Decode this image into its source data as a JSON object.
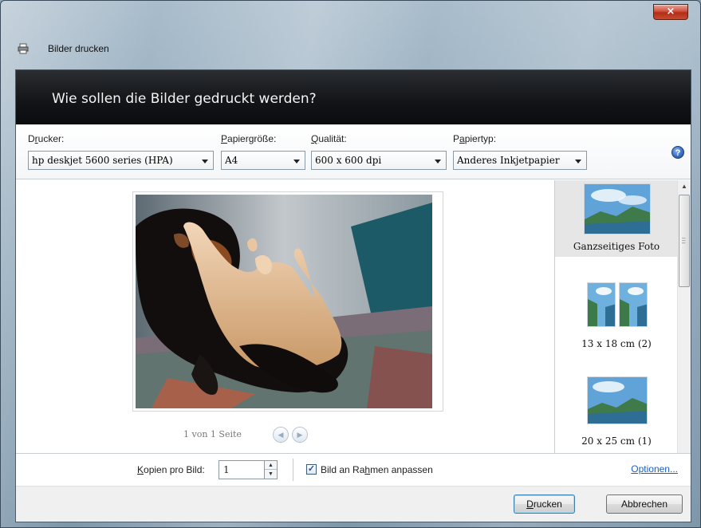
{
  "window": {
    "title": "Bilder drucken",
    "close_glyph": "×"
  },
  "header": {
    "title": "Wie sollen die Bilder gedruckt werden?"
  },
  "settings": {
    "printer": {
      "label_pre": "D",
      "label_ul": "r",
      "label_post": "ucker:",
      "value": "hp deskjet 5600 series (HPA)"
    },
    "paper_size": {
      "label_pre": "",
      "label_ul": "P",
      "label_post": "apiergröße:",
      "value": "A4"
    },
    "quality": {
      "label_pre": "",
      "label_ul": "Q",
      "label_post": "ualität:",
      "value": "600 x 600 dpi"
    },
    "paper_type": {
      "label_pre": "P",
      "label_ul": "a",
      "label_post": "piertyp:",
      "value": "Anderes Inkjetpapier"
    },
    "help_glyph": "?"
  },
  "preview": {
    "pager_text": "1 von 1 Seite",
    "prev_glyph": "◀",
    "next_glyph": "▶"
  },
  "layouts": [
    {
      "label": "Ganzseitiges Foto",
      "selected": true
    },
    {
      "label": "13 x 18 cm (2)",
      "selected": false
    },
    {
      "label": "20 x 25 cm (1)",
      "selected": false
    }
  ],
  "options": {
    "copies_label_pre": "",
    "copies_label_ul": "K",
    "copies_label_post": "opien pro Bild:",
    "copies_value": "1",
    "fit_checked": true,
    "fit_label_pre": "Bild an Ra",
    "fit_label_ul": "h",
    "fit_label_post": "men anpassen",
    "options_link": "Optionen..."
  },
  "buttons": {
    "print_pre": "",
    "print_ul": "D",
    "print_post": "rucken",
    "cancel": "Abbrechen"
  },
  "colors": {
    "header_bg": "#121417",
    "link": "#1b5fc5",
    "close_red": "#c94a2e"
  }
}
